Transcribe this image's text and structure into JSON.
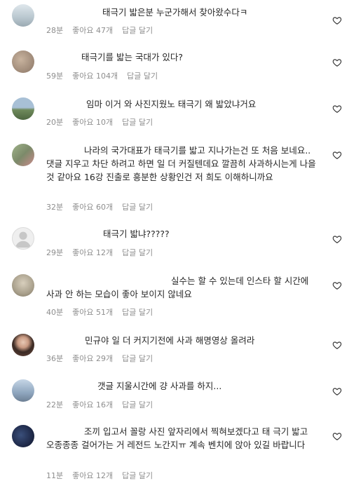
{
  "comments": [
    {
      "text": "태극기 밟은분 누군가해서 찾아왔수다ㅋ",
      "time": "28분",
      "likes": "좋아요 47개",
      "reply": "답글 달기",
      "avatar_color": "#b9c7cf"
    },
    {
      "text": "태극기를 밟는 국대가 있다?",
      "time": "59분",
      "likes": "좋아요 104개",
      "reply": "답글 달기",
      "avatar_color": "#9a8a7a"
    },
    {
      "text": "임마 이거 와 사진지웠노 태극기 왜 밟았냐거요",
      "time": "20분",
      "likes": "좋아요 10개",
      "reply": "답글 달기",
      "avatar_color": "#6f8a5c"
    },
    {
      "text": "나라의 국가대표가 태극기를 밟고 지나가는건 또 처음 보네요.. 댓글 지우고 차단 하려고 하면 일 더 커질텐데요 깔끔히 사과하시는게 나을 것 같아요 16강 진출로 흥분한 상황인건 저 희도 이해하니까요",
      "time": "32분",
      "likes": "좋아요 60개",
      "reply": "답글 달기",
      "avatar_color": "#7c8a6a"
    },
    {
      "text": "태극기 밟냐?????",
      "time": "29분",
      "likes": "좋아요 12개",
      "reply": "답글 달기",
      "avatar_color": "#dbdbdb"
    },
    {
      "text": "실수는 할 수 있는데 인스타 할 시간에 사과 안 하는 모습이 좋아 보이지 않네요",
      "time": "40분",
      "likes": "좋아요 51개",
      "reply": "답글 달기",
      "avatar_color": "#a9a08c"
    },
    {
      "text": "민규야 일 더 커지기전에 사과 해명영상 올려라",
      "time": "36분",
      "likes": "좋아요 29개",
      "reply": "답글 달기",
      "avatar_color": "#6d4a3e"
    },
    {
      "text": "갯글 지울시간에 걍 사과를 하지...",
      "time": "22분",
      "likes": "좋아요 16개",
      "reply": "답글 달기",
      "avatar_color": "#8fa6bf"
    },
    {
      "text": "조끼 입고서 꼴랑 사진 앞자리에서 찍혀보겠다고 태 극기 밟고 오종종종 걸어가는 거 레전드 노간지ㅠ 계속 벤치에 앉아 있길 바랍니다",
      "time": "11분",
      "likes": "좋아요 12개",
      "reply": "답글 달기",
      "avatar_color": "#1f2a4a"
    }
  ]
}
